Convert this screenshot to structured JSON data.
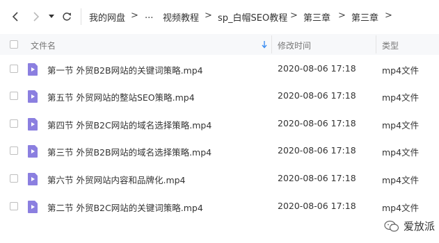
{
  "nav": {
    "back_icon": "chevron-left-icon",
    "forward_icon": "chevron-right-icon",
    "dropdown_icon": "caret-down-icon",
    "refresh_icon": "refresh-icon"
  },
  "breadcrumb": {
    "items": [
      "我的网盘",
      "...",
      "视频教程",
      "sp_白帽SEO教程",
      "第三章",
      "第三章"
    ],
    "separator": ">"
  },
  "columns": {
    "name": "文件名",
    "modified": "修改时间",
    "type": "类型",
    "sort_icon": "sort-down-arrow-icon"
  },
  "files": [
    {
      "name": "第一节 外贸B2B网站的关键词策略.mp4",
      "modified": "2020-08-06 17:18",
      "type": "mp4文件"
    },
    {
      "name": "第五节 外贸网站的整站SEO策略.mp4",
      "modified": "2020-08-06 17:18",
      "type": "mp4文件"
    },
    {
      "name": "第四节 外贸B2C网站的域名选择策略.mp4",
      "modified": "2020-08-06 17:18",
      "type": "mp4文件"
    },
    {
      "name": "第三节 外贸B2B网站的域名选择策略.mp4",
      "modified": "2020-08-06 17:18",
      "type": "mp4文件"
    },
    {
      "name": "第六节 外贸网站内容和品牌化.mp4",
      "modified": "2020-08-06 17:18",
      "type": "mp4文件"
    },
    {
      "name": "第二节 外贸B2C网站的关键词策略.mp4",
      "modified": "2020-08-06 17:18",
      "type": "mp4文件"
    }
  ],
  "colors": {
    "file_icon": "#8b7fe0",
    "sort_arrow": "#3d8ef2"
  },
  "watermark": {
    "text": "爱放派",
    "icon": "wechat-icon"
  }
}
